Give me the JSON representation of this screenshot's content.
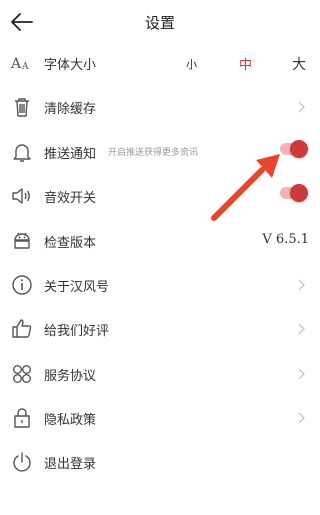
{
  "header": {
    "title": "设置"
  },
  "rows": {
    "font_size": {
      "label": "字体大小",
      "small": "小",
      "medium": "中",
      "large": "大"
    },
    "clear_cache": {
      "label": "清除缓存"
    },
    "push": {
      "label": "推送通知",
      "hint": "开启推送获得更多资讯",
      "toggle": "on"
    },
    "sound": {
      "label": "音效开关",
      "toggle": "on"
    },
    "version": {
      "label": "检查版本",
      "value": "V 6.5.1"
    },
    "about": {
      "label": "关于汉风号"
    },
    "rate": {
      "label": "给我们好评"
    },
    "service": {
      "label": "服务协议"
    },
    "privacy": {
      "label": "隐私政策"
    },
    "logout": {
      "label": "退出登录"
    }
  },
  "colors": {
    "accent": "#cc3a3a",
    "toggle_track": "#f1b3b3",
    "annotation_arrow": "#e8452b"
  },
  "icons": [
    "back-arrow-icon",
    "font-size-icon",
    "trash-icon",
    "bell-icon",
    "speaker-icon",
    "android-icon",
    "info-icon",
    "thumbs-up-icon",
    "grid-petal-icon",
    "lock-icon",
    "power-icon",
    "chevron-right-icon"
  ]
}
